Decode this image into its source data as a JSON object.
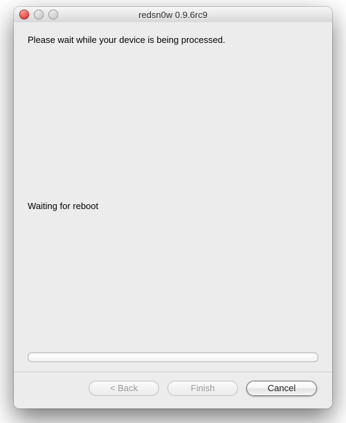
{
  "window": {
    "title": "redsn0w 0.9.6rc9"
  },
  "main": {
    "instruction": "Please wait while your device is being processed.",
    "status": "Waiting for reboot",
    "progress_percent": 0
  },
  "buttons": {
    "back_label": "< Back",
    "back_enabled": false,
    "finish_label": "Finish",
    "finish_enabled": false,
    "cancel_label": "Cancel",
    "cancel_enabled": true
  }
}
